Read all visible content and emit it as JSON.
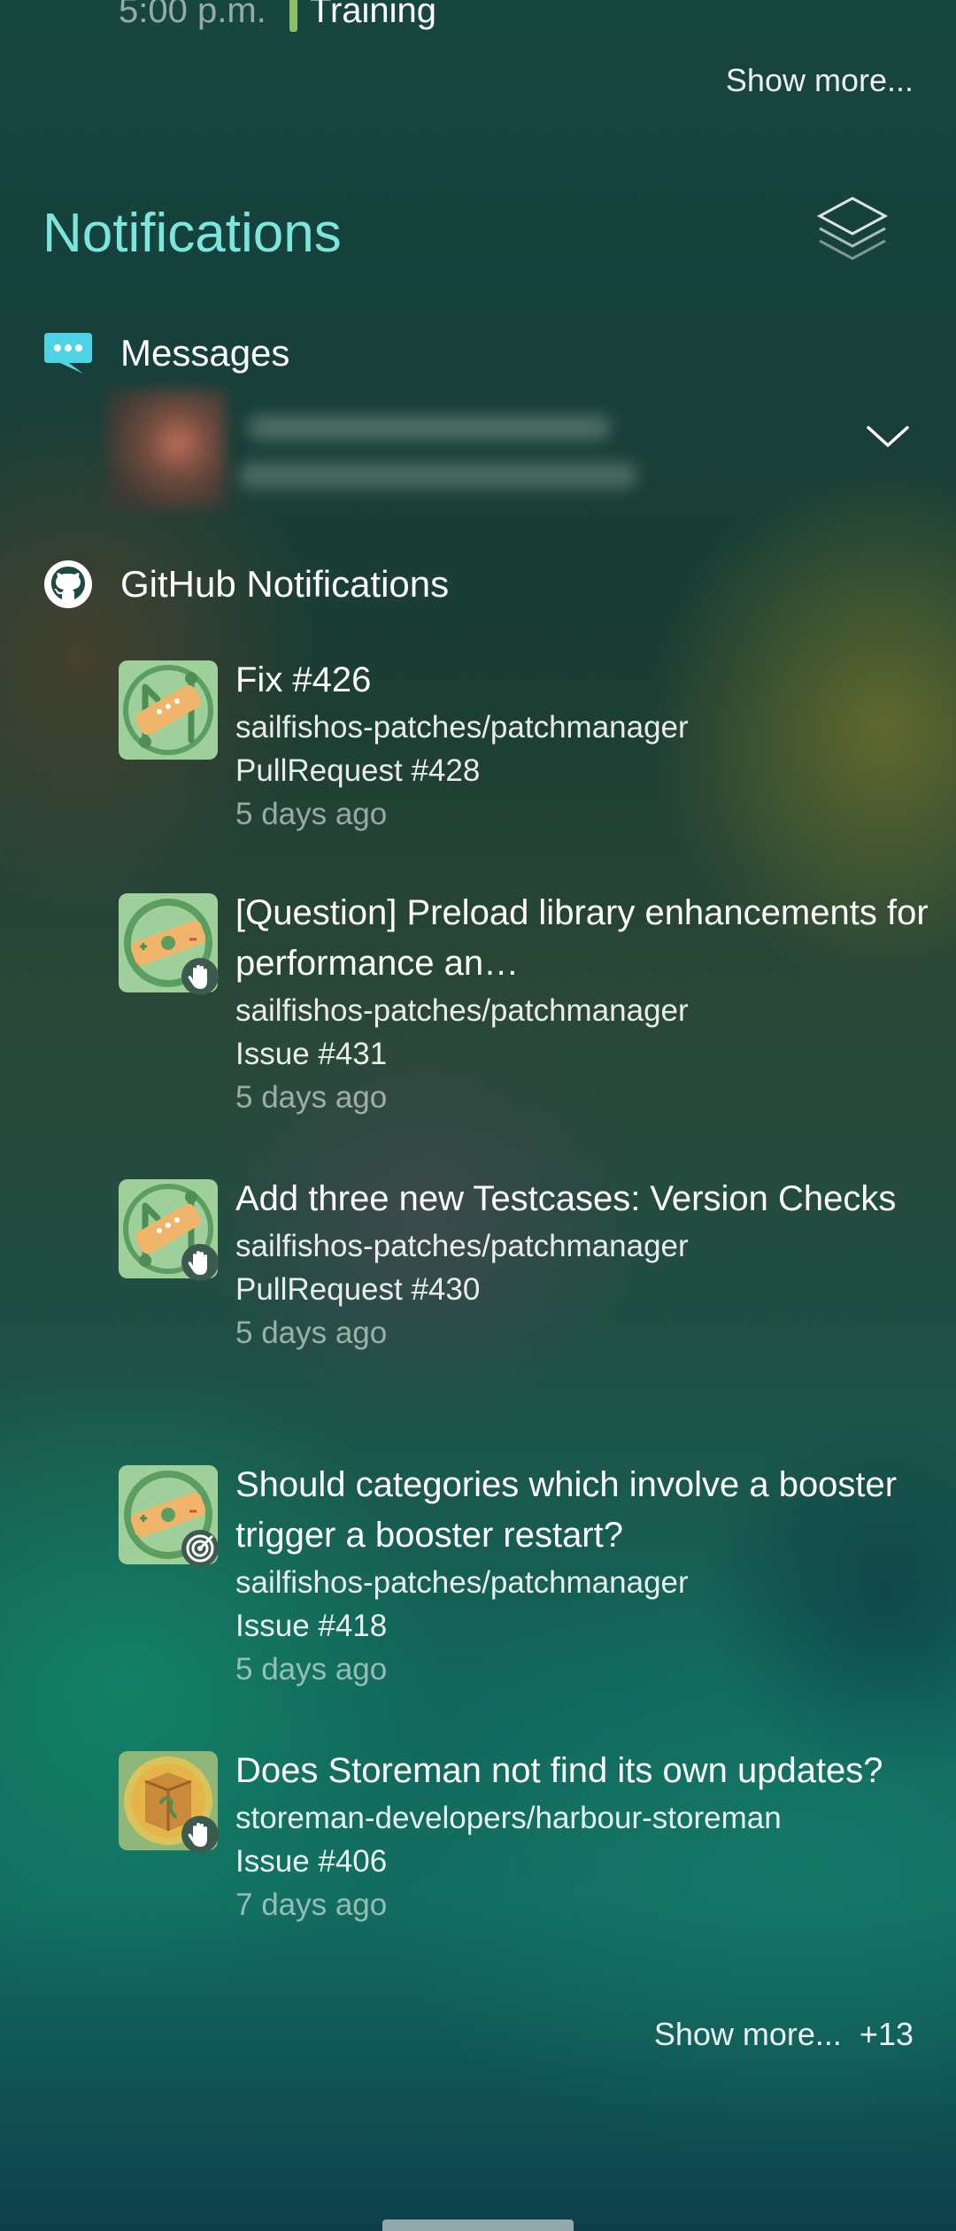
{
  "top_event": {
    "time": "5:00 p.m.",
    "title": "Training",
    "color": "#8ebd64"
  },
  "events": {
    "show_more_label": "Show more..."
  },
  "notifications": {
    "title": "Notifications",
    "accent_color": "#7de6dc",
    "groups": {
      "messages": {
        "label": "Messages",
        "icon": "chat-bubble-icon"
      },
      "github": {
        "label": "GitHub Notifications",
        "icon": "github-octocat-icon",
        "items": [
          {
            "title": "Fix #426",
            "repo": "sailfishos-patches/patchmanager",
            "kind": "PullRequest #428",
            "time": "5 days ago",
            "avatar": "patchmanager-pr-icon",
            "badge": ""
          },
          {
            "title": "[Question] Preload library enhancements for performance an…",
            "repo": "sailfishos-patches/patchmanager",
            "kind": "Issue #431",
            "time": "5 days ago",
            "avatar": "patchmanager-issue-icon",
            "badge": "raised-hand-icon"
          },
          {
            "title": "Add three new Testcases: Version Checks",
            "repo": "sailfishos-patches/patchmanager",
            "kind": "PullRequest #430",
            "time": "5 days ago",
            "avatar": "patchmanager-pr-icon",
            "badge": "raised-hand-icon"
          },
          {
            "title": "Should categories which involve a booster trigger a booster restart?",
            "repo": "sailfishos-patches/patchmanager",
            "kind": "Issue #418",
            "time": "5 days ago",
            "avatar": "patchmanager-issue-icon",
            "badge": "target-icon"
          },
          {
            "title": "Does Storeman not find its own updates?",
            "repo": "storeman-developers/harbour-storeman",
            "kind": "Issue #406",
            "time": "7 days ago",
            "avatar": "storeman-box-icon",
            "badge": "raised-hand-icon"
          }
        ],
        "show_more_label": "Show more...",
        "more_count": "+13"
      }
    }
  }
}
